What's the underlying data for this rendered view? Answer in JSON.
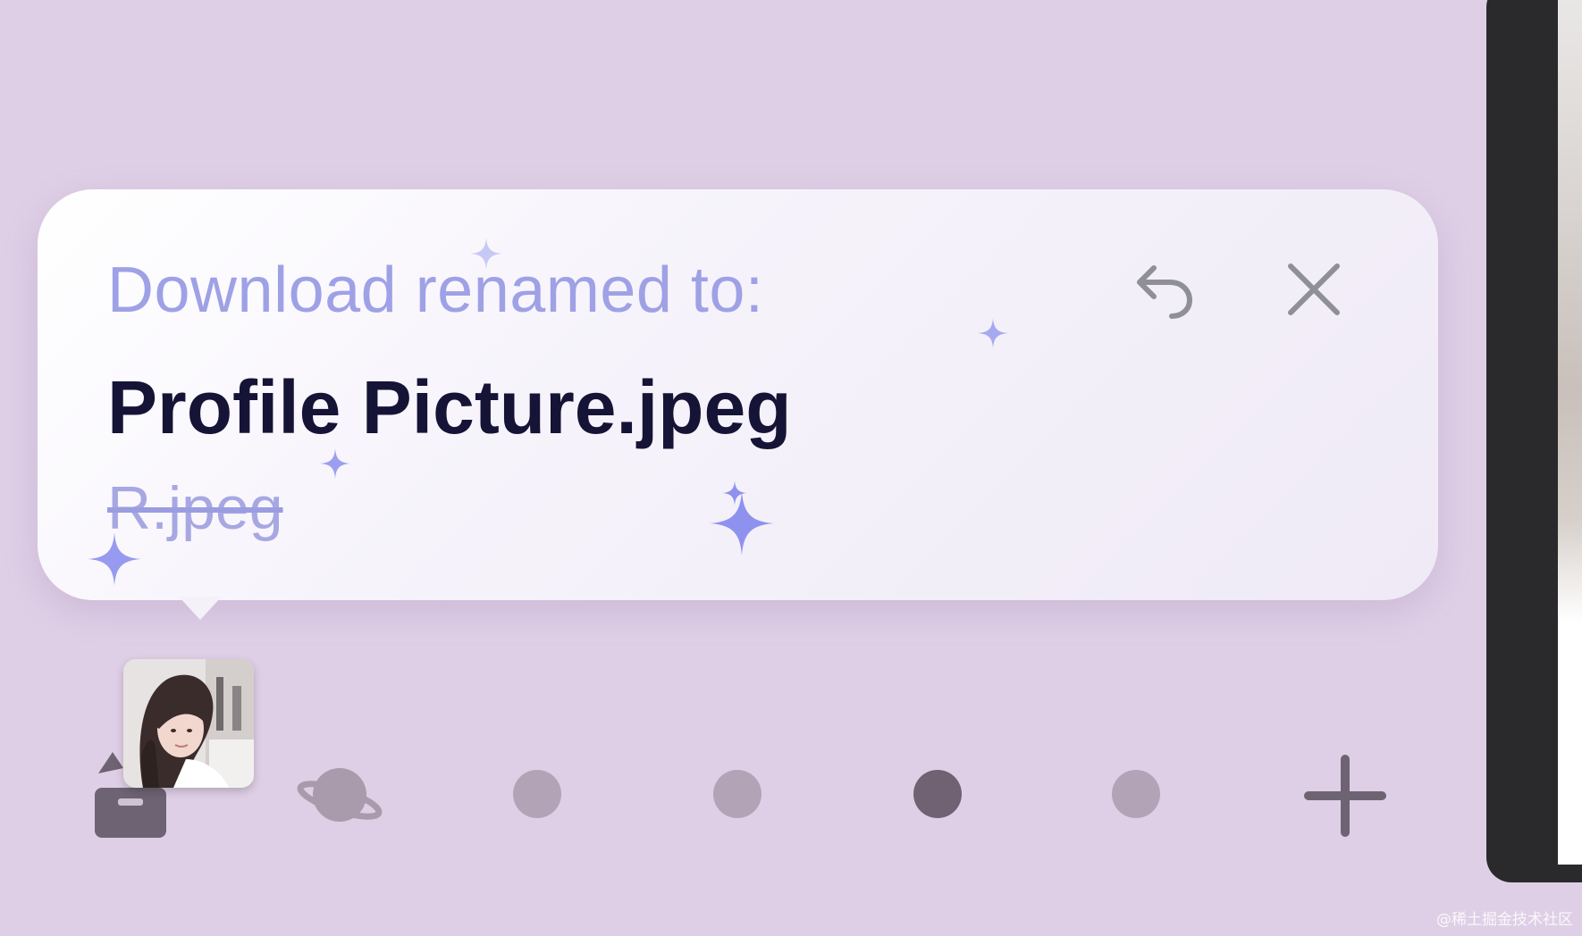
{
  "toast": {
    "heading": "Download renamed to:",
    "new_name": "Profile Picture.jpeg",
    "old_name": "R.jpeg",
    "undo_icon": "undo-arrow-icon",
    "close_icon": "close-icon"
  },
  "dock": {
    "thumbnail": "profile-photo-thumbnail",
    "items": [
      {
        "icon": "archive-tray-icon"
      },
      {
        "icon": "planet-icon"
      },
      {
        "icon": "space-dot"
      },
      {
        "icon": "space-dot"
      },
      {
        "icon": "space-dot",
        "active": true
      },
      {
        "icon": "space-dot"
      },
      {
        "icon": "plus-icon"
      }
    ]
  },
  "watermark": "@稀土掘金技术社区",
  "colors": {
    "background": "#dfcfe6",
    "heading": "#9fa1e6",
    "new_name": "#151436",
    "old_name": "#a7a8e2",
    "sparkle": "#8e92ee",
    "dot": "#b3a3b7",
    "dot_active": "#706272"
  }
}
